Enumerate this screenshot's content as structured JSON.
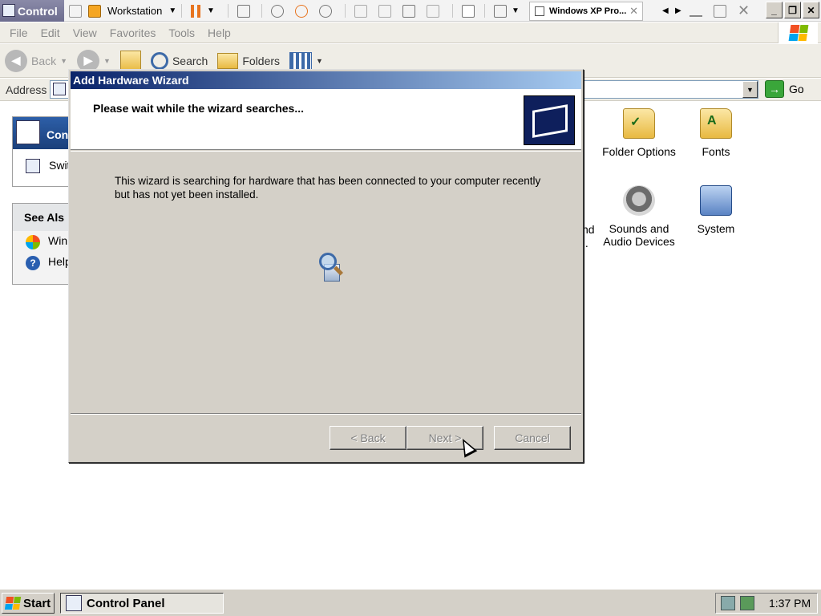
{
  "vmware": {
    "window_title": "Control",
    "vm_menu": "Workstation",
    "tab_label": "Windows XP Pro..."
  },
  "menubar": {
    "items": [
      "File",
      "Edit",
      "View",
      "Favorites",
      "Tools",
      "Help"
    ]
  },
  "toolbar": {
    "back": "Back",
    "search": "Search",
    "folders": "Folders"
  },
  "address": {
    "label": "Address",
    "go": "Go"
  },
  "side_panel": {
    "header": "Con",
    "switch_item": "Swit",
    "see_also": "See Als",
    "windows_item": "Win",
    "help_item": "Help"
  },
  "icons": {
    "folder_options": "Folder Options",
    "fonts": "Fonts",
    "partial_left_1": "nd",
    "partial_left_2": "..",
    "sounds": "Sounds and Audio Devices",
    "system": "System"
  },
  "dialog": {
    "title": "Add Hardware Wizard",
    "heading": "Please wait while the wizard searches...",
    "body": "This wizard is searching for hardware that has been connected to your computer recently but has not yet been installed.",
    "back_button": "< Back",
    "next_button": "Next >",
    "cancel_button": "Cancel"
  },
  "taskbar": {
    "start": "Start",
    "task": "Control Panel",
    "clock": "1:37 PM"
  },
  "colors": {
    "titlebar_dark": "#0a246a",
    "titlebar_light": "#a6caf0",
    "dialog_face": "#d4d0c8"
  }
}
